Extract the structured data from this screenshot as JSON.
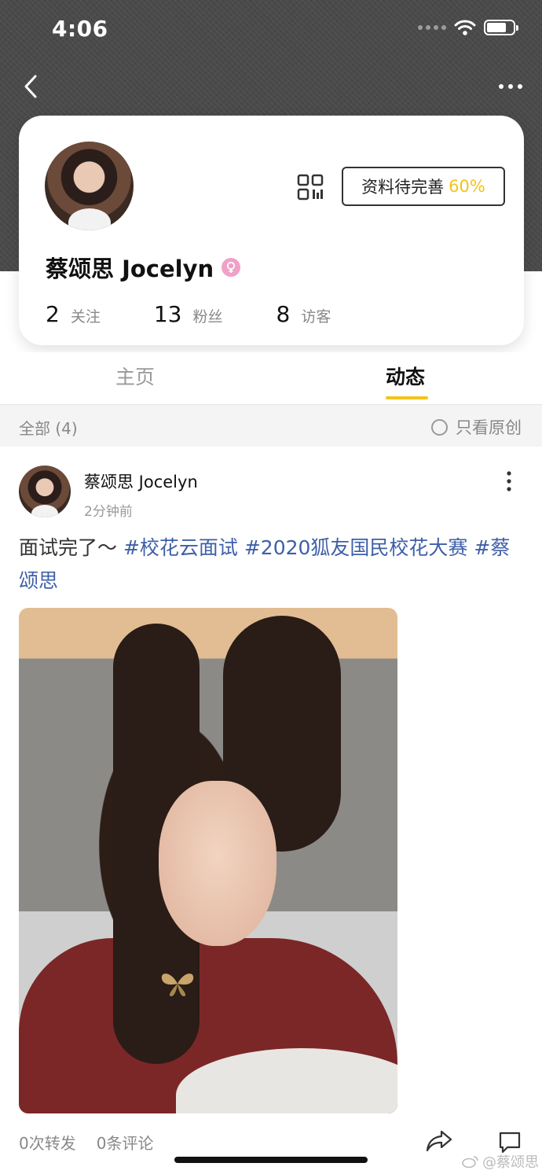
{
  "status_bar": {
    "time": "4:06"
  },
  "nav": {
    "back_icon": "chevron-left-icon",
    "more_icon": "more-horizontal-icon"
  },
  "profile": {
    "name": "蔡颂思 Jocelyn",
    "gender_icon": "female-icon",
    "qr_icon": "qr-code-icon",
    "complete_label": "资料待完善",
    "complete_percent": "60%",
    "stats": [
      {
        "value": "2",
        "label": "关注"
      },
      {
        "value": "13",
        "label": "粉丝"
      },
      {
        "value": "8",
        "label": "访客"
      }
    ]
  },
  "tabs": {
    "home": "主页",
    "feed": "动态",
    "active": "feed"
  },
  "filter": {
    "all": "全部 (4)",
    "original_only": "只看原创"
  },
  "post": {
    "author": "蔡颂思 Jocelyn",
    "time": "2分钟前",
    "text_plain": "面试完了～ ",
    "tag1": "#校花云面试",
    "tag2": "#2020狐友国民校花大赛",
    "tag3": "#蔡颂思",
    "reposts": "0次转发",
    "comments": "0条评论"
  },
  "watermark": "@蔡颂思",
  "colors": {
    "accent": "#f3c31a",
    "tag": "#3e5fa8",
    "header_bg": "#4a4a4a"
  }
}
